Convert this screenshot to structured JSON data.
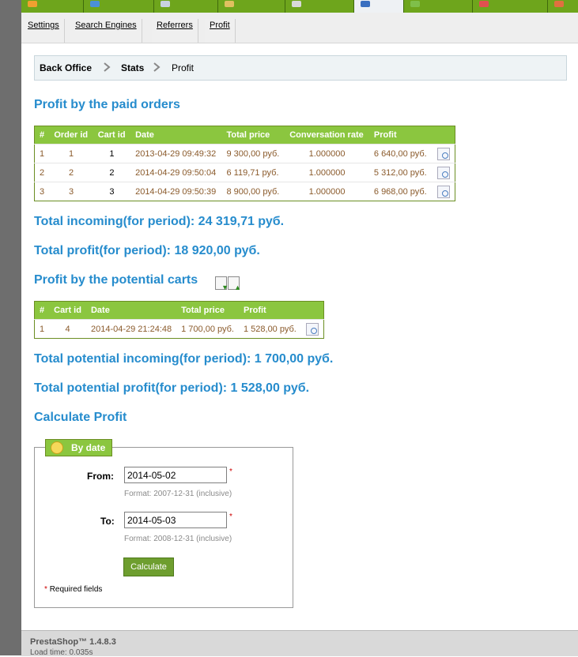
{
  "subnav": {
    "items": [
      {
        "label": "Settings"
      },
      {
        "label": "Search Engines"
      },
      {
        "label": "Referrers"
      },
      {
        "label": "Profit"
      }
    ]
  },
  "breadcrumb": [
    "Back Office",
    "Stats",
    "Profit"
  ],
  "paid_orders": {
    "title": "Profit by the paid orders",
    "columns": [
      "#",
      "Order id",
      "Cart id",
      "Date",
      "Total price",
      "Conversation rate",
      "Profit"
    ],
    "rows": [
      {
        "num": "1",
        "order_id": "1",
        "cart_id": "1",
        "date": "2013-04-29 09:49:32",
        "total": "9 300,00 руб.",
        "rate": "1.000000",
        "profit": "6 640,00 руб."
      },
      {
        "num": "2",
        "order_id": "2",
        "cart_id": "2",
        "date": "2014-04-29 09:50:04",
        "total": "6 119,71 руб.",
        "rate": "1.000000",
        "profit": "5 312,00 руб."
      },
      {
        "num": "3",
        "order_id": "3",
        "cart_id": "3",
        "date": "2014-04-29 09:50:39",
        "total": "8 900,00 руб.",
        "rate": "1.000000",
        "profit": "6 968,00 руб."
      }
    ]
  },
  "totals": {
    "incoming": "Total incoming(for period): 24 319,71 руб.",
    "profit": "Total profit(for period): 18 920,00 руб."
  },
  "potential_carts": {
    "title": "Profit by the potential carts",
    "columns": [
      "#",
      "Cart id",
      "Date",
      "Total price",
      "Profit"
    ],
    "rows": [
      {
        "num": "1",
        "cart_id": "4",
        "date": "2014-04-29 21:24:48",
        "total": "1 700,00 руб.",
        "profit": "1 528,00 руб."
      }
    ]
  },
  "potential_totals": {
    "incoming": "Total potential incoming(for period): 1 700,00 руб.",
    "profit": "Total potential profit(for period): 1 528,00 руб."
  },
  "calculate": {
    "title": "Calculate Profit",
    "legend": "By date",
    "from_label": "From:",
    "from_value": "2014-05-02",
    "from_format": "Format: 2007-12-31 (inclusive)",
    "to_label": "To:",
    "to_value": "2014-05-03",
    "to_format": "Format: 2008-12-31 (inclusive)",
    "required_star": "*",
    "button": "Calculate",
    "required_note": "Required fields"
  },
  "footer": {
    "version": "PrestaShop™ 1.4.8.3",
    "load_time": "Load time: 0.035s"
  },
  "colors": {
    "accent": "#8bc63f",
    "heading": "#268ccd",
    "link_value": "#8a5a2b"
  }
}
